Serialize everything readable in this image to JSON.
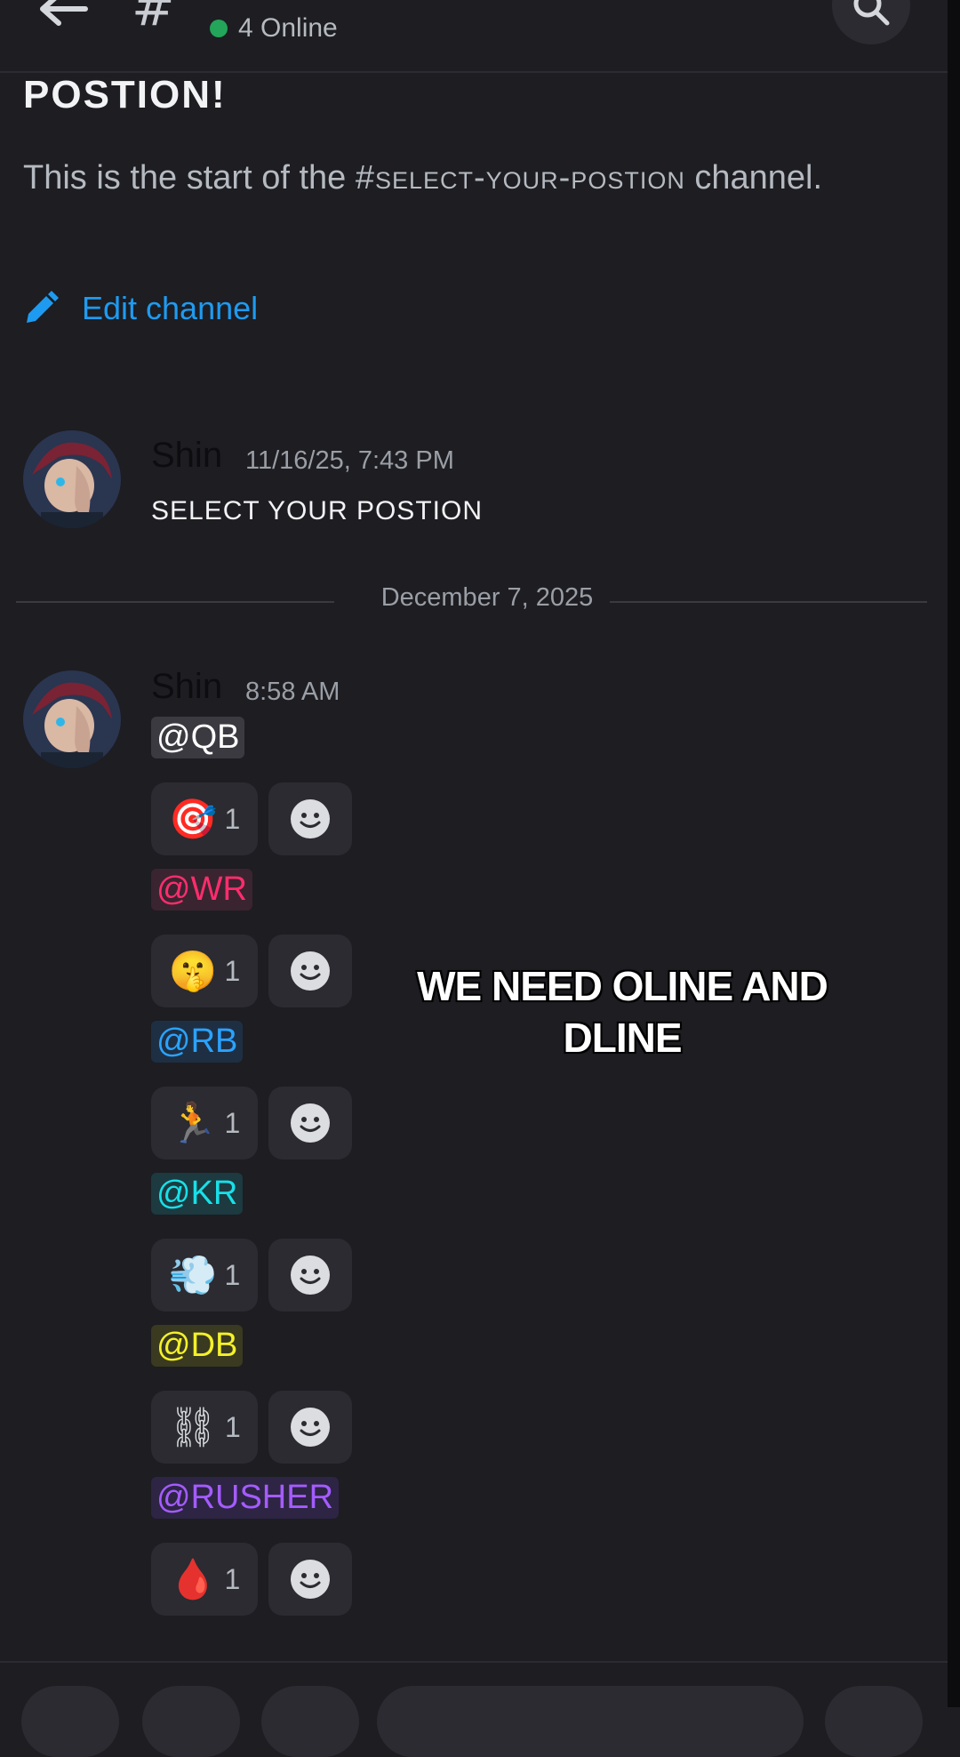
{
  "header": {
    "online_text": "4 Online"
  },
  "intro": {
    "title": "POSTION!",
    "desc_prefix": "This is the start of the ",
    "desc_channel": "#select-your-postion",
    "desc_suffix": " channel.",
    "edit_label": "Edit channel"
  },
  "messages": [
    {
      "author": "Shin",
      "time": "11/16/25, 7:43 PM",
      "text": "SELECT YOUR POSTION"
    },
    {
      "author": "Shin",
      "time": "8:58 AM"
    }
  ],
  "date_divider": "December 7, 2025",
  "roles": [
    {
      "mention": "@QB",
      "emoji": "🎯",
      "count": "1",
      "color": "#ffffff",
      "bg": "#3a3a40"
    },
    {
      "mention": "@WR",
      "emoji": "🤫",
      "count": "1",
      "color": "#ff2d6d",
      "bg": "#3a2430"
    },
    {
      "mention": "@RB",
      "emoji": "🏃",
      "count": "1",
      "color": "#2aa3ff",
      "bg": "#1e2f44"
    },
    {
      "mention": "@KR",
      "emoji": "💨",
      "count": "1",
      "color": "#18e0e8",
      "bg": "#1c3a40"
    },
    {
      "mention": "@DB",
      "emoji": "⛓",
      "count": "1",
      "color": "#f4f12a",
      "bg": "#3a3a20"
    },
    {
      "mention": "@RUSHER",
      "emoji": "🩸",
      "count": "1",
      "color": "#a45cff",
      "bg": "#2e2444"
    }
  ],
  "caption": "WE NEED OLINE AND DLINE",
  "colors": {
    "background": "#1d1d22",
    "accent_link": "#1e9bf0",
    "online_dot": "#23a55a"
  }
}
